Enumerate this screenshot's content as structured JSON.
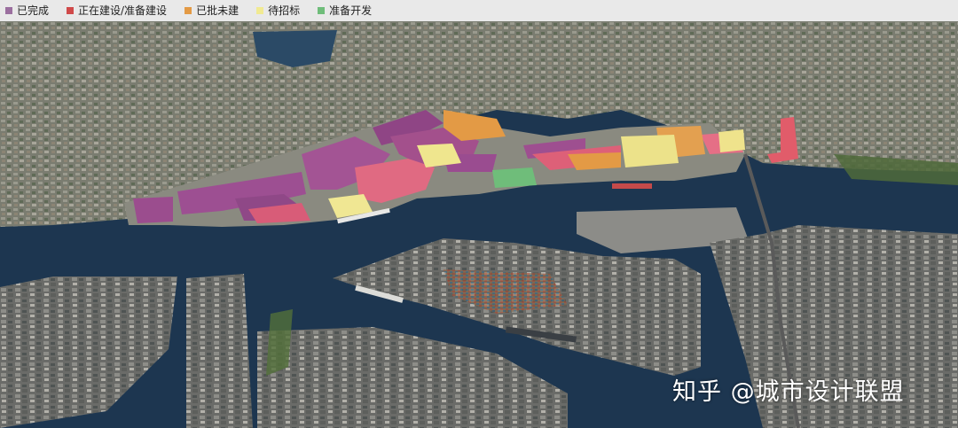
{
  "legend": [
    {
      "label": "已完成",
      "color": "#9b6f9f"
    },
    {
      "label": "正在建设/准备建设",
      "color": "#d04a4a"
    },
    {
      "label": "已批未建",
      "color": "#e39a45"
    },
    {
      "label": "待招标",
      "color": "#f1ea92"
    },
    {
      "label": "准备开发",
      "color": "#6fbd7a"
    }
  ],
  "watermark": "知乎 @城市设计联盟",
  "colors": {
    "water": "#1d3650",
    "land_old_city": "#7c7f72",
    "port": "#6e6e6a",
    "completed": "#9b4d8e",
    "under_construction": "#e0607a",
    "approved": "#e39a45",
    "tender": "#efe68e",
    "prepare": "#6fbd7a"
  }
}
